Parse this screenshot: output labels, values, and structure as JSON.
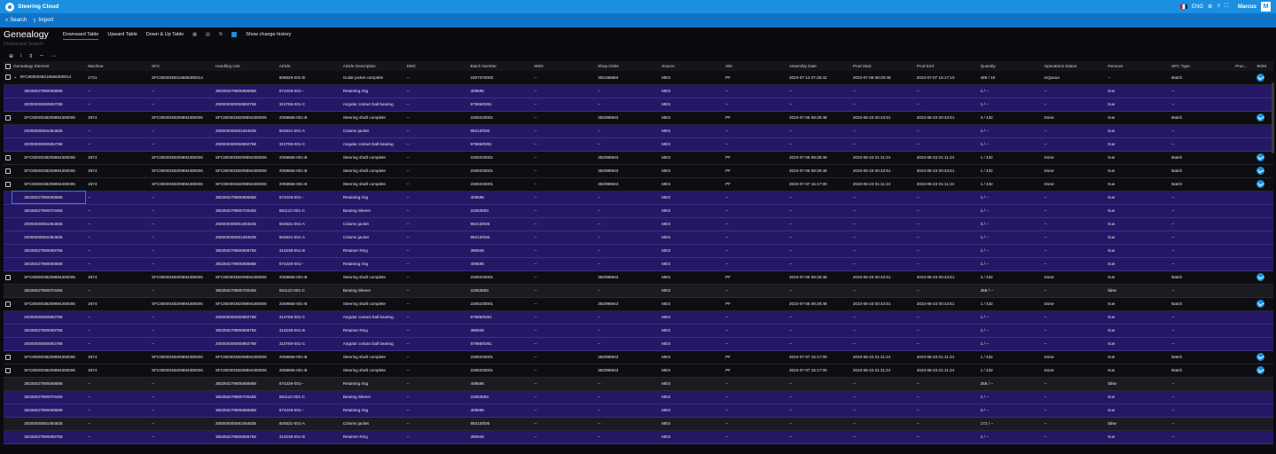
{
  "app": {
    "title": "Steering Cloud",
    "language": "ENG",
    "user": "Marcus",
    "avatar_letter": "M"
  },
  "subbar": {
    "search_label": "Search",
    "import_label": "Import"
  },
  "header": {
    "title": "Genealogy",
    "tabs": [
      "Downward Table",
      "Upward Table",
      "Down & Up Table"
    ],
    "active_tab": 0,
    "show_history_label": "Show change history"
  },
  "search": {
    "placeholder": "Downward Search"
  },
  "columns": [
    "Genealogy Element",
    "Machine",
    "SFC",
    "Handling Unit",
    "Article",
    "Article Description",
    "DMC",
    "Batch Number",
    "MSN",
    "Shop Order",
    "Source",
    "Site",
    "Assembly Date",
    "Prod Start",
    "Prod End",
    "Quantity",
    "Operations Status",
    "Remove",
    "SFC Type",
    "Proc...",
    "BOM"
  ],
  "rows": [
    {
      "kind": "main",
      "chk": true,
      "caret": true,
      "bom": true,
      "c": [
        "SFC8000038216566300014",
        "2731",
        "SFC8000038216566300014",
        "",
        "606629-001-B",
        "Guide jacket complete",
        "--",
        "2307070003",
        "--",
        "382165663",
        "MES",
        "PF",
        "2023-07-13 07:28:42",
        "2023-07-06 08:29:46",
        "2023-07-07 15:17:10",
        "489 / 15",
        "inQueue",
        "--",
        "Batch",
        ""
      ]
    },
    {
      "kind": "child",
      "c": [
        "38335027990068588",
        "--",
        "--",
        "383350279906885888",
        "674229-001--",
        "Retaining ring",
        "--",
        "409598",
        "--",
        "--",
        "MES",
        "--",
        "--",
        "--",
        "--",
        "1 / --",
        "--",
        "true",
        "--",
        ""
      ]
    },
    {
      "kind": "child",
      "c": [
        "20000000050892788",
        "--",
        "--",
        "200000000050892788",
        "310759-001-C",
        "Angular contact ball bearing",
        "--",
        "97986/0061",
        "--",
        "--",
        "MES",
        "--",
        "--",
        "--",
        "--",
        "1 / --",
        "--",
        "true",
        "--",
        ""
      ]
    },
    {
      "kind": "main",
      "chk": true,
      "bom": true,
      "c": [
        "SFC8000038209894300005",
        "2674",
        "SFC8000038209894300005",
        "SFC8000038209894300005",
        "2059656-001-B",
        "Steering shaft complete",
        "--",
        "2306230001",
        "--",
        "382098943",
        "MES",
        "PF",
        "2023-07-06 08:29:48",
        "2023-06-23 00:43:51",
        "2023-06-23 00:43:51",
        "3 / 432",
        "Done",
        "true",
        "Batch",
        ""
      ]
    },
    {
      "kind": "child",
      "c": [
        "20000000061084835",
        "--",
        "--",
        "200000000061084835",
        "604531-001-A",
        "Column jacket",
        "--",
        "99210/006",
        "--",
        "--",
        "MES",
        "--",
        "--",
        "--",
        "--",
        "1 / --",
        "--",
        "true",
        "--",
        ""
      ]
    },
    {
      "kind": "child",
      "c": [
        "20000000050892788",
        "--",
        "--",
        "200000000050892788",
        "310759-001-C",
        "Angular contact ball bearing",
        "--",
        "97986/0061",
        "--",
        "--",
        "MES",
        "--",
        "--",
        "--",
        "--",
        "1 / --",
        "--",
        "true",
        "--",
        ""
      ]
    },
    {
      "kind": "main",
      "chk": true,
      "bom": true,
      "c": [
        "SFC8000038209894300006",
        "2674",
        "SFC8000038209894300006",
        "SFC8000038209894300006",
        "2059656-001-B",
        "Steering shaft complete",
        "--",
        "2306230001",
        "--",
        "382098943",
        "MES",
        "PF",
        "2023-07-06 08:29:49",
        "2023-06-23 01:11:24",
        "2023-06-23 01:11:24",
        "1 / 432",
        "Done",
        "true",
        "Batch",
        ""
      ]
    },
    {
      "kind": "main",
      "chk": true,
      "bom": true,
      "c": [
        "SFC8000038209894300006",
        "2674",
        "SFC8000038209894300006",
        "SFC8000038209894300006",
        "2059656-001-B",
        "Steering shaft complete",
        "--",
        "2306230001",
        "--",
        "382098943",
        "MES",
        "PF",
        "2023-07-06 08:29:49",
        "2023-06-23 00:43:51",
        "2023-06-23 00:43:51",
        "1 / 432",
        "Done",
        "true",
        "Batch",
        ""
      ]
    },
    {
      "kind": "main",
      "chk": true,
      "bom": true,
      "c": [
        "SFC8000038209894300006",
        "2674",
        "SFC8000038209894300006",
        "SFC8000038209894300006",
        "2059656-001-B",
        "Steering shaft complete",
        "--",
        "2306230001",
        "--",
        "382098943",
        "MES",
        "PF",
        "2023-07-07 15:17:00",
        "2023-06-23 01:11:24",
        "2023-06-23 01:11:24",
        "1 / 432",
        "Done",
        "true",
        "Batch",
        ""
      ]
    },
    {
      "kind": "child",
      "sel": true,
      "c": [
        "38335027990068588",
        "--",
        "--",
        "383350279906885888",
        "674229-001--",
        "Retaining ring",
        "--",
        "409598",
        "--",
        "--",
        "MES",
        "--",
        "--",
        "--",
        "--",
        "1 / --",
        "--",
        "true",
        "--",
        ""
      ]
    },
    {
      "kind": "child",
      "c": [
        "38335027990070455",
        "--",
        "--",
        "383350279900700455",
        "581122-001-C",
        "Bearing Sleeve",
        "--",
        "22553883",
        "--",
        "--",
        "MES",
        "--",
        "--",
        "--",
        "--",
        "1 / --",
        "--",
        "true",
        "--",
        ""
      ]
    },
    {
      "kind": "child",
      "c": [
        "20000000061084835",
        "--",
        "--",
        "200000000061084835",
        "604531-001-A",
        "Column jacket",
        "--",
        "99210/006",
        "--",
        "--",
        "MES",
        "--",
        "--",
        "--",
        "--",
        "3 / --",
        "--",
        "true",
        "--",
        ""
      ]
    },
    {
      "kind": "child",
      "c": [
        "20000000061084835",
        "--",
        "--",
        "200000000061084835",
        "604531-001-A",
        "Column jacket",
        "--",
        "99210/006",
        "--",
        "--",
        "MES",
        "--",
        "--",
        "--",
        "--",
        "1 / --",
        "--",
        "true",
        "--",
        ""
      ]
    },
    {
      "kind": "child",
      "c": [
        "38335027990068756",
        "--",
        "--",
        "383350279900688756",
        "315238-001-B",
        "Retainer Ring",
        "--",
        "395946",
        "--",
        "--",
        "MES",
        "--",
        "--",
        "--",
        "--",
        "1 / --",
        "--",
        "true",
        "--",
        ""
      ]
    },
    {
      "kind": "child",
      "c": [
        "38335027990068588",
        "--",
        "--",
        "383350279906885888",
        "674229-001--",
        "Retaining ring",
        "--",
        "409598",
        "--",
        "--",
        "MES",
        "--",
        "--",
        "--",
        "--",
        "1 / --",
        "--",
        "true",
        "--",
        ""
      ]
    },
    {
      "kind": "main",
      "chk": true,
      "bom": true,
      "c": [
        "SFC8000038209894300005",
        "2674",
        "SFC8000038209894300005",
        "SFC8000038209894300005",
        "2059656-001-B",
        "Steering shaft complete",
        "--",
        "2306230001",
        "--",
        "382098943",
        "MES",
        "PF",
        "2023-07-06 08:29:48",
        "2023-06-23 00:43:51",
        "2023-06-23 00:43:51",
        "4 / 432",
        "Done",
        "true",
        "Batch",
        ""
      ]
    },
    {
      "kind": "gray",
      "c": [
        "38335027990070455",
        "--",
        "--",
        "383350279900700455",
        "581122-001-C",
        "Bearing Sleeve",
        "--",
        "22553883",
        "--",
        "--",
        "MES",
        "--",
        "--",
        "--",
        "--",
        "358 / --",
        "--",
        "false",
        "--",
        ""
      ]
    },
    {
      "kind": "main",
      "chk": true,
      "bom": true,
      "c": [
        "SFC8000038209894300005",
        "2674",
        "SFC8000038209894300005",
        "SFC8000038209894300005",
        "2059656-001-B",
        "Steering shaft complete",
        "--",
        "2306230001",
        "--",
        "382098943",
        "MES",
        "PF",
        "2023-07-06 08:29:48",
        "2023-06-23 00:43:51",
        "2023-06-23 00:43:51",
        "1 / 432",
        "Done",
        "true",
        "Batch",
        ""
      ]
    },
    {
      "kind": "child",
      "c": [
        "20000000050892788",
        "--",
        "--",
        "200000000050892788",
        "310759-001-C",
        "Angular contact ball bearing",
        "--",
        "97986/0061",
        "--",
        "--",
        "MES",
        "--",
        "--",
        "--",
        "--",
        "1 / --",
        "--",
        "true",
        "--",
        ""
      ]
    },
    {
      "kind": "child",
      "c": [
        "38335027990068756",
        "--",
        "--",
        "383350279900688756",
        "315238-001-B",
        "Retainer Ring",
        "--",
        "395946",
        "--",
        "--",
        "MES",
        "--",
        "--",
        "--",
        "--",
        "1 / --",
        "--",
        "true",
        "--",
        ""
      ]
    },
    {
      "kind": "child",
      "c": [
        "20000000050892788",
        "--",
        "--",
        "200000000050892788",
        "310759-001-C",
        "Angular contact ball bearing",
        "--",
        "97986/0061",
        "--",
        "--",
        "MES",
        "--",
        "--",
        "--",
        "--",
        "1 / --",
        "--",
        "true",
        "--",
        ""
      ]
    },
    {
      "kind": "main",
      "chk": true,
      "bom": true,
      "c": [
        "SFC8000038209894300006",
        "2674",
        "SFC8000038209894300006",
        "SFC8000038209894300006",
        "2059656-001-B",
        "Steering shaft complete",
        "--",
        "2306230001",
        "--",
        "382098943",
        "MES",
        "PF",
        "2023-07-07 15:17:00",
        "2023-06-23 01:11:24",
        "2023-06-23 01:11:24",
        "1 / 432",
        "Done",
        "true",
        "Batch",
        ""
      ]
    },
    {
      "kind": "main",
      "chk": true,
      "bom": true,
      "c": [
        "SFC8000038209894300006",
        "2674",
        "SFC8000038209894300006",
        "SFC8000038209894300006",
        "2059656-001-B",
        "Steering shaft complete",
        "--",
        "2306230001",
        "--",
        "382098943",
        "MES",
        "PF",
        "2023-07-07 15:17:00",
        "2023-06-23 01:11:24",
        "2023-06-23 01:11:24",
        "1 / 432",
        "Done",
        "true",
        "Batch",
        ""
      ]
    },
    {
      "kind": "gray",
      "c": [
        "38335027990068588",
        "--",
        "--",
        "383350279906885888",
        "674229-001--",
        "Retaining ring",
        "--",
        "409598",
        "--",
        "--",
        "MES",
        "--",
        "--",
        "--",
        "--",
        "358 / --",
        "--",
        "false",
        "--",
        ""
      ]
    },
    {
      "kind": "child",
      "c": [
        "38335027990070455",
        "--",
        "--",
        "383350279900700455",
        "581122-001-C",
        "Bearing Sleeve",
        "--",
        "22553883",
        "--",
        "--",
        "MES",
        "--",
        "--",
        "--",
        "--",
        "1 / --",
        "--",
        "true",
        "--",
        ""
      ]
    },
    {
      "kind": "child",
      "c": [
        "38335027990068588",
        "--",
        "--",
        "383350279906885888",
        "674229-001--",
        "Retaining ring",
        "--",
        "409598",
        "--",
        "--",
        "MES",
        "--",
        "--",
        "--",
        "--",
        "4 / --",
        "--",
        "true",
        "--",
        ""
      ]
    },
    {
      "kind": "gray",
      "c": [
        "20000000061084835",
        "--",
        "--",
        "200000000061084835",
        "604531-001-A",
        "Column jacket",
        "--",
        "99210/006",
        "--",
        "--",
        "MES",
        "--",
        "--",
        "--",
        "--",
        "172 / --",
        "--",
        "false",
        "--",
        ""
      ]
    },
    {
      "kind": "child",
      "c": [
        "38335027990068756",
        "--",
        "--",
        "383350279900688756",
        "315238-001-B",
        "Retainer Ring",
        "--",
        "395946",
        "--",
        "--",
        "MES",
        "--",
        "--",
        "--",
        "--",
        "1 / --",
        "--",
        "true",
        "--",
        ""
      ]
    }
  ]
}
